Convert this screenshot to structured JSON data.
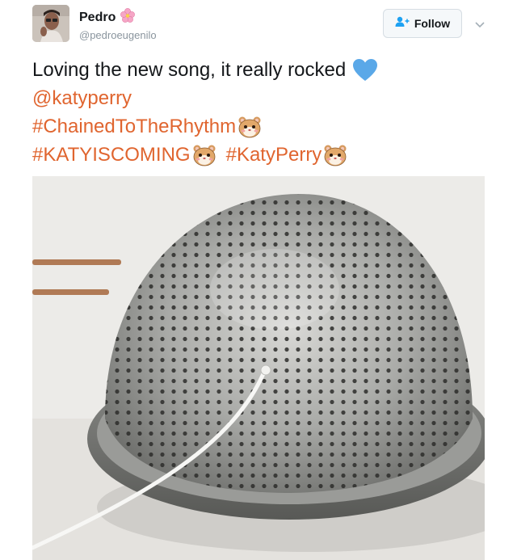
{
  "user": {
    "display_name": "Pedro",
    "handle": "@pedroeugenilo"
  },
  "follow_button": {
    "label": "Follow"
  },
  "tweet": {
    "text": "Loving the new song, it really rocked",
    "mention": "@katyperry",
    "hashtags": [
      "#ChainedToTheRhythm",
      "#KATYISCOMING",
      "#KatyPerry"
    ]
  },
  "colors": {
    "link": "#e0652f",
    "heart": "#5aa8e8",
    "follow_icon": "#1da1f2"
  },
  "icons": {
    "name_emoji": "pink-flower-icon",
    "heart": "blue-heart-icon",
    "hashtag_emoji": "hamster-face-icon",
    "follow": "add-user-icon",
    "menu": "chevron-down-icon"
  },
  "media": {
    "description_icon": "photo"
  }
}
